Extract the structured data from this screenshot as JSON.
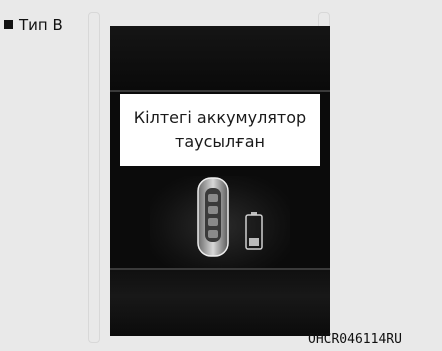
{
  "section": {
    "bullet_icon": "black-square-icon",
    "label": "Тип B"
  },
  "display": {
    "message_line1": "Кілтегі аккумулятор",
    "message_line2": "таусылған",
    "icons": [
      "smart-key-fob-icon",
      "battery-icon"
    ]
  },
  "figure_code": "OHCR046114RU"
}
